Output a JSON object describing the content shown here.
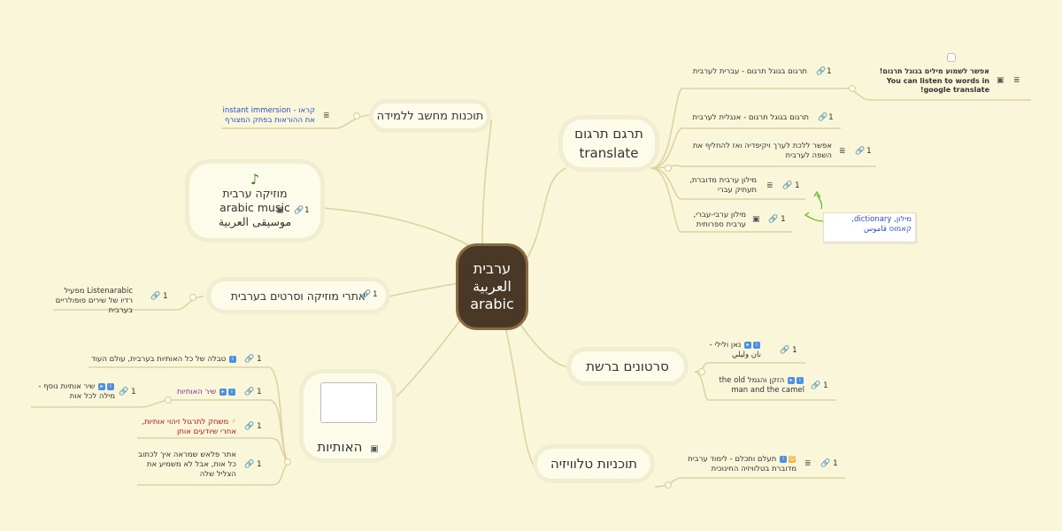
{
  "central": {
    "line1": "ערבית",
    "line2": "العربية",
    "line3": "arabic"
  },
  "translate": {
    "title1": "תרגם תרגום",
    "title2": "translate",
    "items": [
      {
        "text": "תרגום בגוגל תרגום - עברית לערבית",
        "count": "1"
      },
      {
        "text": "תרגום בגוגל תרגום - אנגלית לערבית",
        "count": "1"
      },
      {
        "text": "אפשר ללכת לערך ויקיפדיה ואז להחליף את השפה לערבית",
        "count": "1"
      },
      {
        "text": "מילון ערבית מדוברת, תעתיק עברי",
        "count": "1"
      },
      {
        "text": "מילון ערבי-עברי, ערבית ספרותית",
        "count": "1"
      }
    ],
    "note1": {
      "line1": "אפשר לשמוע מילים בגוגל תרגום!",
      "line2": "You can listen to words in",
      "line3": "google translate!"
    },
    "note2": "מילון, dictionary, קאמוס قاموس"
  },
  "videos": {
    "title": "סרטונים ברשת",
    "items": [
      {
        "text": "נאן ולילי - نان وليلي",
        "count": "1"
      },
      {
        "text": "הזקן והגמל the old man and the camel",
        "count": "1"
      }
    ]
  },
  "tv": {
    "title": "תוכניות טלוויזיה",
    "items": [
      {
        "text": "תעלם ותכלם - לימוד ערבית מדוברת בטלוויזיה החינוכית",
        "count": "1"
      }
    ]
  },
  "software": {
    "title": "תוכנות מחשב ללמידה",
    "note": "קראו - instant immersion את ההוראות בפתק המצורף"
  },
  "music": {
    "note_icon": "♪",
    "line1": "מוזיקה ערבית",
    "line2": "arabic music",
    "line3": "موسيقى العربية",
    "count": "1"
  },
  "sites": {
    "title": "אתרי מוזיקה וסרטים בערבית",
    "count": "1",
    "leaf": {
      "text": "Listenarabic מפעיל רדיו של שירים פופולריים בערבית",
      "count": "1"
    }
  },
  "letters": {
    "title": "האותיות",
    "items": [
      {
        "text": "טבלה של כל האותיות בערבית, עולם העוד",
        "count": "1"
      },
      {
        "text": "שיר האותיות",
        "count": "1"
      },
      {
        "text": "משחק לתרגול זיהוי אותיות, אחרי שיודעים אותן",
        "count": "1"
      },
      {
        "text": "אתר פלאש שמראה איך לכתוב כל אות, אבל לא משמיע את הצליל שלה",
        "count": "1"
      }
    ],
    "sub": {
      "text": "שיר אותיות נוסף - מילה לכל אות",
      "count": "1"
    }
  },
  "colors": {
    "bg": "#faf6d9",
    "line": "#ddd3a2",
    "central": "#4a3826",
    "green": "#66bb22"
  }
}
